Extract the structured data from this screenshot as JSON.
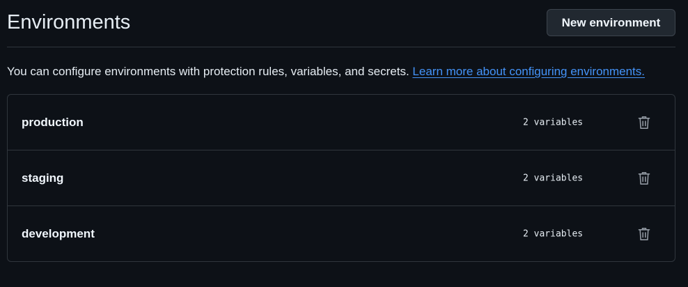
{
  "header": {
    "title": "Environments",
    "new_button_label": "New environment"
  },
  "description": {
    "text": "You can configure environments with protection rules, variables, and secrets.",
    "link_text": "Learn more about configuring environments."
  },
  "environments": [
    {
      "name": "production",
      "variables": "2 variables",
      "delete_icon": "trash-icon"
    },
    {
      "name": "staging",
      "variables": "2 variables",
      "delete_icon": "trash-icon"
    },
    {
      "name": "development",
      "variables": "2 variables",
      "delete_icon": "trash-icon"
    }
  ],
  "colors": {
    "background": "#0d1117",
    "border": "#30363d",
    "link": "#4493f8",
    "text": "#e6edf3",
    "icon": "#9198a1"
  }
}
